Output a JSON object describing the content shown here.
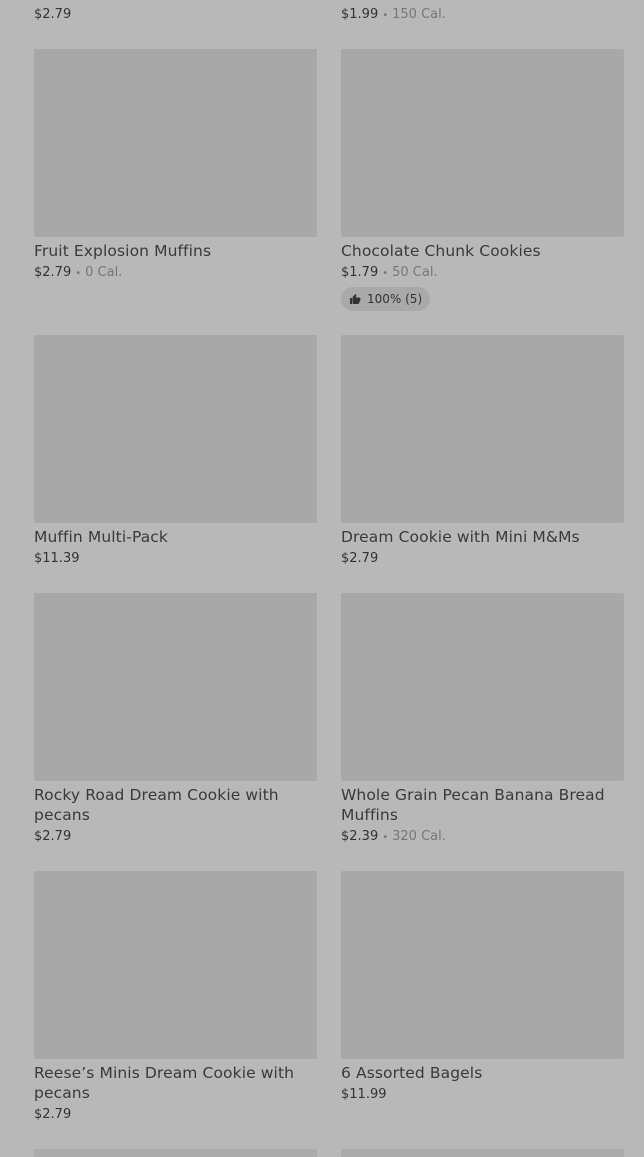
{
  "top_row": {
    "left_price": "$2.79",
    "right_price": "$1.99",
    "right_calories": "150 Cal."
  },
  "products": [
    {
      "name": "Fruit Explosion Muffins",
      "price": "$2.79",
      "calories": "0 Cal."
    },
    {
      "name": "Chocolate Chunk Cookies",
      "price": "$1.79",
      "calories": "50 Cal.",
      "rating": "100% (5)"
    },
    {
      "name": "Muffin Multi-Pack",
      "price": "$11.39"
    },
    {
      "name": "Dream Cookie with Mini M&Ms",
      "price": "$2.79"
    },
    {
      "name": "Rocky Road Dream Cookie with pecans",
      "price": "$2.79"
    },
    {
      "name": "Whole Grain Pecan Banana Bread Muffins",
      "price": "$2.39",
      "calories": "320 Cal."
    },
    {
      "name": "Reese’s Minis Dream Cookie with pecans",
      "price": "$2.79"
    },
    {
      "name": "6 Assorted Bagels",
      "price": "$11.99"
    }
  ],
  "separator": "•",
  "colors": {
    "background": "#b8b8b8",
    "thumbnail": "#a8a8a8",
    "text": "#3a3a3a",
    "muted": "#767676"
  }
}
